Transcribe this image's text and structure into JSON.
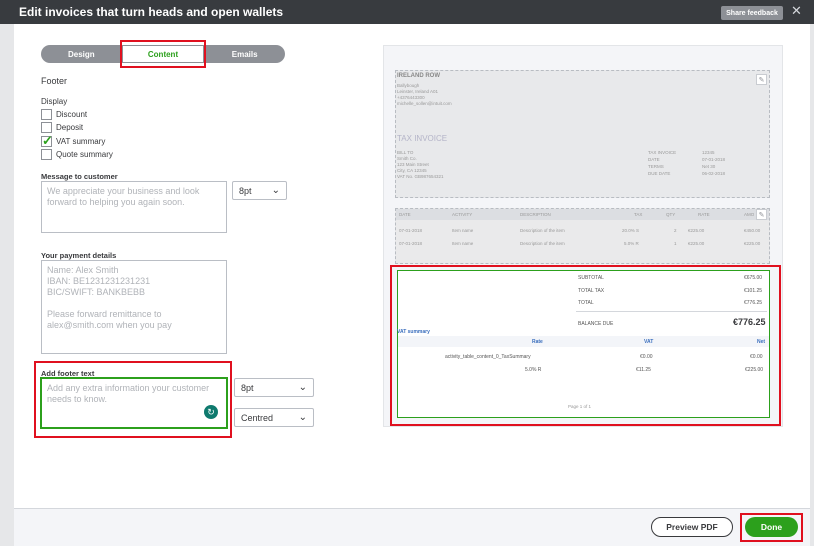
{
  "window": {
    "title": "Edit invoices that turn heads and open wallets",
    "share_feedback": "Share feedback",
    "close_icon": "close-icon"
  },
  "tabs": [
    {
      "label": "Design"
    },
    {
      "label": "Content",
      "active": true
    },
    {
      "label": "Emails"
    }
  ],
  "left": {
    "section_title": "Footer",
    "display_label": "Display",
    "checkboxes": [
      {
        "label": "Discount",
        "checked": false
      },
      {
        "label": "Deposit",
        "checked": false
      },
      {
        "label": "VAT summary",
        "checked": true
      },
      {
        "label": "Quote summary",
        "checked": false
      }
    ],
    "message_label": "Message to customer",
    "message_placeholder": "We appreciate your business and look forward to helping you again soon.",
    "message_font_size": "8pt",
    "payment_label": "Your payment details",
    "payment_placeholder": "Name: Alex Smith\nIBAN: BE1231231231231\nBIC/SWIFT: BANKBEBB\n\nPlease forward remittance to alex@smith.com when you pay",
    "footer_label": "Add footer text",
    "footer_placeholder": "Add any extra information your customer needs to know.",
    "footer_font_size": "8pt",
    "footer_align": "Centred"
  },
  "preview": {
    "company": {
      "name": "IRELAND ROW",
      "lines": [
        "Ballybough",
        "Leinster, Ireland A01",
        "+4376443300",
        "michelle_sollen@intuit.com"
      ]
    },
    "doc_title": "TAX INVOICE",
    "bill_to": {
      "label": "BILL TO",
      "lines": [
        "Smith Co.",
        "123 Main Street",
        "City, CA 12345",
        "VAT No. GB987654321"
      ]
    },
    "meta": [
      {
        "k": "TAX INVOICE",
        "v": "12345"
      },
      {
        "k": "DATE",
        "v": "07-01-2018"
      },
      {
        "k": "TERMS",
        "v": "Net 30"
      },
      {
        "k": "DUE DATE",
        "v": "06-02-2018"
      }
    ],
    "table_headers": [
      "DATE",
      "ACTIVITY",
      "DESCRIPTION",
      "TAX",
      "QTY",
      "RATE",
      "AMO"
    ],
    "table_rows": [
      [
        "07-01-2018",
        "Item name",
        "Description of the item",
        "20.0% S",
        "2",
        "€225.00",
        "€450.00"
      ],
      [
        "07-01-2018",
        "Item name",
        "Description of the item",
        "5.0% R",
        "1",
        "€225.00",
        "€225.00"
      ]
    ],
    "totals": [
      {
        "k": "SUBTOTAL",
        "v": "€675.00"
      },
      {
        "k": "TOTAL TAX",
        "v": "€101.25"
      },
      {
        "k": "TOTAL",
        "v": "€776.25"
      }
    ],
    "balance_due_label": "BALANCE DUE",
    "balance_due": "€776.25",
    "vat_summary_title": "VAT summary",
    "vat_headers": [
      "Rate",
      "VAT",
      "Net"
    ],
    "vat_rows": [
      [
        "activity_table_content_0_TaxSummary",
        "€0.00",
        "€0.00"
      ],
      [
        "5.0% R",
        "€11.25",
        "€225.00"
      ]
    ],
    "page": "Page 1 of 1"
  },
  "footer": {
    "preview_pdf": "Preview PDF",
    "done": "Done"
  },
  "colors": {
    "accent": "#2ca01c",
    "highlight": "#e0101f",
    "titlebar": "#383b3f"
  }
}
